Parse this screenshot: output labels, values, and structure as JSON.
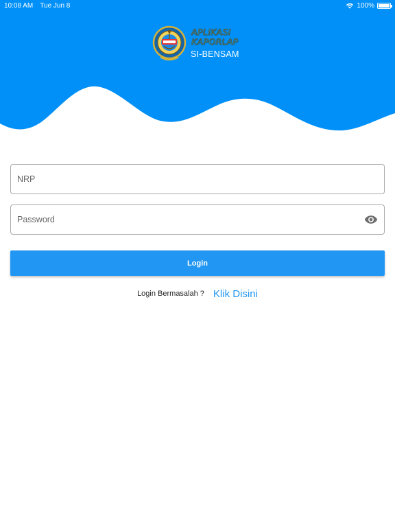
{
  "status_bar": {
    "time": "10:08 AM",
    "date": "Tue Jun 8",
    "battery": "100%",
    "icons": [
      "wifi-icon",
      "battery-icon"
    ]
  },
  "logo": {
    "line1": "APLIKASI",
    "line2": "KAPORLAP",
    "subtitle": "SI-BENSAM",
    "emblem": "emblem-icon"
  },
  "form": {
    "nrp_placeholder": "NRP",
    "nrp_value": "",
    "password_placeholder": "Password",
    "password_value": "",
    "password_toggle_icon": "eye-icon",
    "login_label": "Login"
  },
  "help": {
    "text": "Login Bermasalah ?",
    "link": "Klik Disini"
  },
  "colors": {
    "primary": "#2196f3",
    "header_blue": "#0090f8",
    "field_border": "#a9a9a9"
  }
}
